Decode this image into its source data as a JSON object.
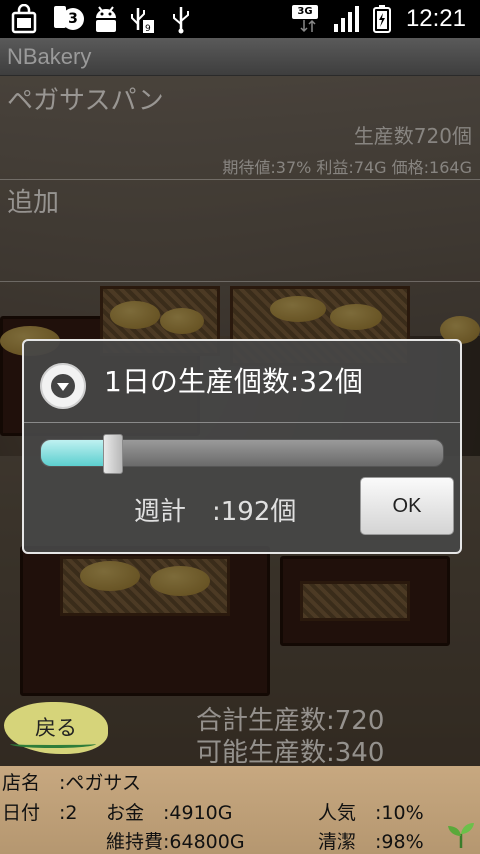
{
  "status_bar": {
    "notification_count": "3",
    "network": "3G",
    "time": "12:21",
    "icons": [
      "shopping-bag-icon",
      "notification-count-icon",
      "android-debug-icon",
      "usb-icon",
      "usb-icon",
      "3g-icon",
      "signal-icon",
      "battery-icon"
    ]
  },
  "app": {
    "title": "NBakery"
  },
  "list": {
    "items": [
      {
        "title": "ペガサスパン",
        "production": "生産数720個",
        "detail": "期待値:37% 利益:74G 価格:164G"
      },
      {
        "title": "追加"
      }
    ]
  },
  "dialog": {
    "title": "1日の生産個数:32個",
    "slider_fraction": 0.18,
    "weekly_total": "週計　:192個",
    "ok_label": "OK"
  },
  "totals": {
    "total_production": "合計生産数:720",
    "possible_production": "可能生産数:340"
  },
  "back_label": "戻る",
  "info": {
    "shop_name": "店名　:ペガサス",
    "day": "日付　:2",
    "money": "お金　:4910G",
    "upkeep": "維持費:64800G",
    "popularity": "人気　:10%",
    "cleanliness": "清潔　:98%"
  },
  "colors": {
    "slider_fill": "#5ccfcf",
    "panel_bg": "#c0a27b",
    "back_button_bg": "#d6d47a"
  }
}
